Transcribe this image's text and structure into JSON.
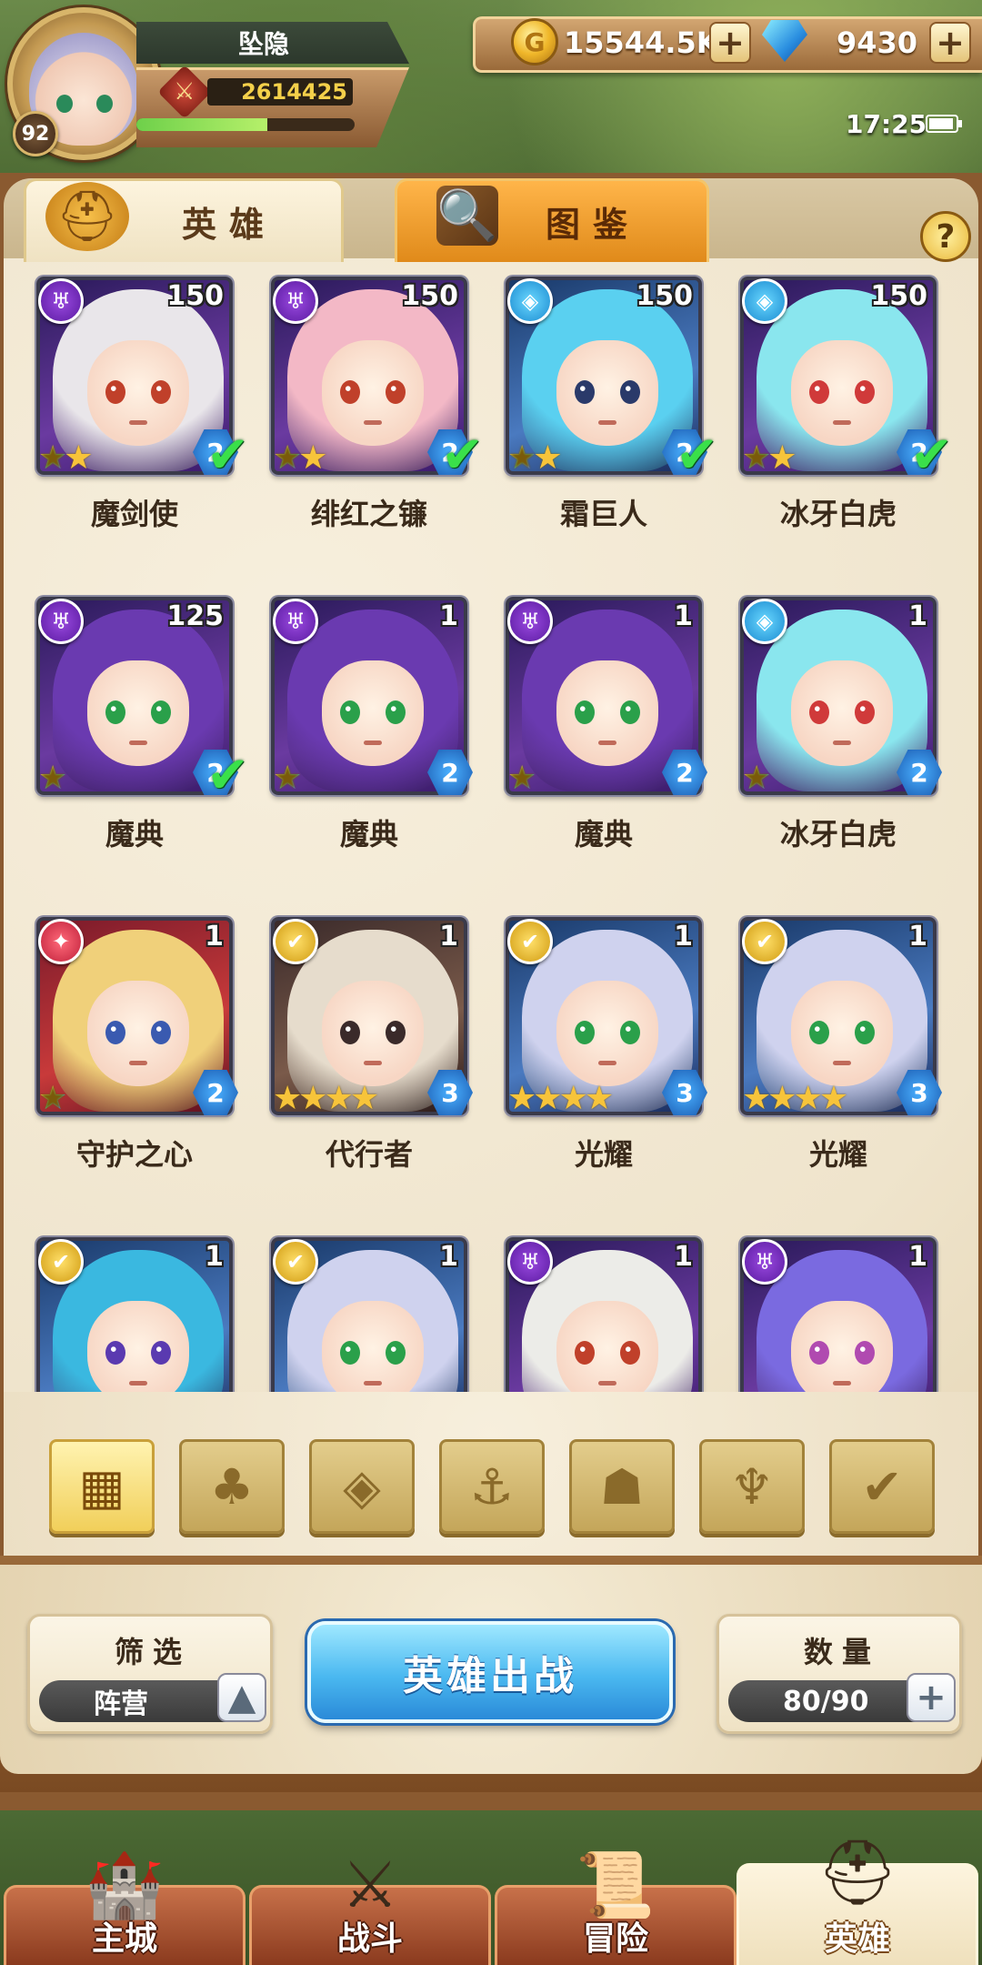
{
  "player": {
    "name": "坠隐",
    "level": "92",
    "power": "2614425",
    "exp_fraction": 0.6
  },
  "resources": {
    "gold": "15544.5K",
    "gems": "9430",
    "plus": "+"
  },
  "status": {
    "time": "17:25"
  },
  "tabs": [
    {
      "label": "英雄",
      "icon": "helmet-icon"
    },
    {
      "label": "图鉴",
      "icon": "magnifier-icon"
    }
  ],
  "help": "?",
  "heroes": [
    {
      "name": "魔剑使",
      "level": "150",
      "faction": "dark",
      "stars": 2,
      "star_type": "rainbow",
      "rank": "2",
      "selected": true,
      "bg": "purple",
      "hair": "#e9e6ea",
      "eye": "#c0402a"
    },
    {
      "name": "绯红之镰",
      "level": "150",
      "faction": "dark",
      "stars": 2,
      "star_type": "rainbow",
      "rank": "2",
      "selected": true,
      "bg": "purple",
      "hair": "#f3b8c6",
      "eye": "#c0402a"
    },
    {
      "name": "霜巨人",
      "level": "150",
      "faction": "ice",
      "stars": 2,
      "star_type": "rainbow",
      "rank": "2",
      "selected": true,
      "bg": "blue",
      "hair": "#5ad0f0",
      "eye": "#2a3a6a"
    },
    {
      "name": "冰牙白虎",
      "level": "150",
      "faction": "ice",
      "stars": 2,
      "star_type": "rainbow",
      "rank": "2",
      "selected": true,
      "bg": "purple",
      "hair": "#8ae6ee",
      "eye": "#d03a3a"
    },
    {
      "name": "魔典",
      "level": "125",
      "faction": "dark",
      "stars": 1,
      "star_type": "rainbow",
      "rank": "2",
      "selected": true,
      "bg": "purple",
      "hair": "#6a3ab0",
      "eye": "#2aa04a"
    },
    {
      "name": "魔典",
      "level": "1",
      "faction": "dark",
      "stars": 1,
      "star_type": "rainbow",
      "rank": "2",
      "selected": false,
      "bg": "purple",
      "hair": "#6a3ab0",
      "eye": "#2aa04a"
    },
    {
      "name": "魔典",
      "level": "1",
      "faction": "dark",
      "stars": 1,
      "star_type": "rainbow",
      "rank": "2",
      "selected": false,
      "bg": "purple",
      "hair": "#6a3ab0",
      "eye": "#2aa04a"
    },
    {
      "name": "冰牙白虎",
      "level": "1",
      "faction": "ice",
      "stars": 1,
      "star_type": "rainbow",
      "rank": "2",
      "selected": false,
      "bg": "purple",
      "hair": "#8ae6ee",
      "eye": "#d03a3a"
    },
    {
      "name": "守护之心",
      "level": "1",
      "faction": "fire",
      "stars": 1,
      "star_type": "rainbow",
      "rank": "2",
      "selected": false,
      "bg": "red",
      "hair": "#f0d07a",
      "eye": "#3a5ab0"
    },
    {
      "name": "代行者",
      "level": "1",
      "faction": "light",
      "stars": 4,
      "star_type": "gold",
      "rank": "3",
      "selected": false,
      "bg": "dark",
      "hair": "#e6dccc",
      "eye": "#3a2a2a"
    },
    {
      "name": "光耀",
      "level": "1",
      "faction": "light",
      "stars": 4,
      "star_type": "gold",
      "rank": "3",
      "selected": false,
      "bg": "blue",
      "hair": "#cfd2ee",
      "eye": "#2aa04a"
    },
    {
      "name": "光耀",
      "level": "1",
      "faction": "light",
      "stars": 4,
      "star_type": "gold",
      "rank": "3",
      "selected": false,
      "bg": "blue",
      "hair": "#cfd2ee",
      "eye": "#2aa04a"
    },
    {
      "name": "",
      "level": "1",
      "faction": "light",
      "stars": 0,
      "star_type": "gold",
      "rank": "",
      "selected": false,
      "bg": "blue",
      "hair": "#3ab8e0",
      "eye": "#5a3ab0"
    },
    {
      "name": "",
      "level": "1",
      "faction": "light",
      "stars": 0,
      "star_type": "gold",
      "rank": "",
      "selected": false,
      "bg": "blue",
      "hair": "#cfd2ee",
      "eye": "#2aa04a"
    },
    {
      "name": "",
      "level": "1",
      "faction": "dark",
      "stars": 0,
      "star_type": "gold",
      "rank": "",
      "selected": false,
      "bg": "purple",
      "hair": "#ecece8",
      "eye": "#c0402a"
    },
    {
      "name": "",
      "level": "1",
      "faction": "dark",
      "stars": 0,
      "star_type": "gold",
      "rank": "",
      "selected": false,
      "bg": "purple",
      "hair": "#7a6ae0",
      "eye": "#b04ab0"
    }
  ],
  "faction_filters": [
    {
      "name": "all",
      "icon": "grid-icon",
      "glyph": "▦",
      "active": true
    },
    {
      "name": "nature",
      "icon": "leaf-icon",
      "glyph": "♣",
      "active": false
    },
    {
      "name": "ice",
      "icon": "ice-emblem-icon",
      "glyph": "◈",
      "active": false
    },
    {
      "name": "sea",
      "icon": "anchor-icon",
      "glyph": "⚓",
      "active": false
    },
    {
      "name": "beast",
      "icon": "beast-head-icon",
      "glyph": "☗",
      "active": false
    },
    {
      "name": "dark",
      "icon": "demon-horn-icon",
      "glyph": "♆",
      "active": false
    },
    {
      "name": "light",
      "icon": "wing-icon",
      "glyph": "✔",
      "active": false
    }
  ],
  "filter_box": {
    "title": "筛选",
    "value": "阵营"
  },
  "battle_button": "英雄出战",
  "count_box": {
    "title": "数量",
    "value": "80/90"
  },
  "nav": [
    {
      "label": "主城",
      "icon": "castle-icon",
      "active": false
    },
    {
      "label": "战斗",
      "icon": "crossed-swords-icon",
      "active": false
    },
    {
      "label": "冒险",
      "icon": "scroll-map-icon",
      "active": false
    },
    {
      "label": "英雄",
      "icon": "hero-helmet-icon",
      "active": true
    }
  ],
  "colors": {
    "rainbow_star": "#ff4a6a",
    "gold_star": "#f7c43a",
    "selected_check": "#3ae04a",
    "rank_badge": "#2a7ad8",
    "battle_button": "#4ab8f0"
  }
}
